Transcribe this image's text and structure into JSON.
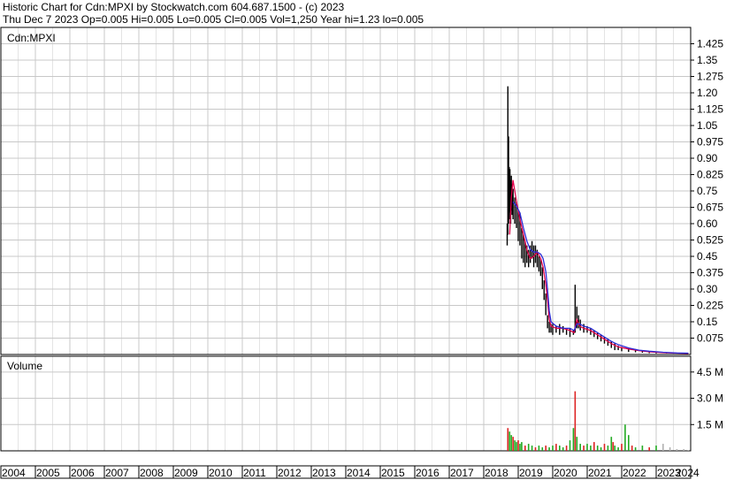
{
  "header": {
    "line1": "Historic Chart for Cdn:MPXI by Stockwatch.com 604.687.1500 - (c) 2023",
    "line2": "Thu Dec  7 2023  Op=0.005  Hi=0.005  Lo=0.005  Cl=0.005  Vol=1,250  Year hi=1.23  lo=0.005"
  },
  "chart_data": [
    {
      "type": "line",
      "title": "Cdn:MPXI",
      "ylim": [
        0,
        1.5
      ],
      "y_ticks": [
        "1.425",
        "1.35",
        "1.275",
        "1.20",
        "1.125",
        "1.05",
        "0.975",
        "0.90",
        "0.825",
        "0.75",
        "0.675",
        "0.60",
        "0.525",
        "0.45",
        "0.375",
        "0.30",
        "0.225",
        "0.15",
        "0.075"
      ],
      "y_tick_values": [
        1.425,
        1.35,
        1.275,
        1.2,
        1.125,
        1.05,
        0.975,
        0.9,
        0.825,
        0.75,
        0.675,
        0.6,
        0.525,
        0.45,
        0.375,
        0.3,
        0.225,
        0.15,
        0.075
      ],
      "x_range": [
        2004,
        2024
      ],
      "series": [
        {
          "values": [
            [
              2018.75,
              0.55
            ],
            [
              2018.8,
              0.72
            ],
            [
              2018.85,
              0.8
            ],
            [
              2018.95,
              0.7
            ],
            [
              2019.05,
              0.62
            ],
            [
              2019.15,
              0.55
            ],
            [
              2019.25,
              0.48
            ],
            [
              2019.35,
              0.44
            ],
            [
              2019.45,
              0.45
            ],
            [
              2019.55,
              0.47
            ],
            [
              2019.65,
              0.44
            ],
            [
              2019.72,
              0.4
            ],
            [
              2019.8,
              0.32
            ],
            [
              2019.85,
              0.25
            ],
            [
              2019.9,
              0.16
            ],
            [
              2019.95,
              0.13
            ],
            [
              2020.1,
              0.12
            ],
            [
              2020.3,
              0.12
            ],
            [
              2020.5,
              0.11
            ],
            [
              2020.62,
              0.1
            ],
            [
              2020.7,
              0.16
            ],
            [
              2020.78,
              0.13
            ],
            [
              2020.9,
              0.12
            ],
            [
              2021.1,
              0.11
            ],
            [
              2021.3,
              0.09
            ],
            [
              2021.5,
              0.07
            ],
            [
              2021.7,
              0.05
            ],
            [
              2021.9,
              0.035
            ],
            [
              2022.2,
              0.025
            ],
            [
              2022.5,
              0.018
            ],
            [
              2022.8,
              0.012
            ],
            [
              2023.2,
              0.008
            ],
            [
              2023.6,
              0.006
            ],
            [
              2023.93,
              0.005
            ]
          ]
        },
        {
          "values": [
            [
              2018.85,
              0.7
            ],
            [
              2018.95,
              0.68
            ],
            [
              2019.05,
              0.65
            ],
            [
              2019.15,
              0.58
            ],
            [
              2019.25,
              0.52
            ],
            [
              2019.35,
              0.48
            ],
            [
              2019.45,
              0.47
            ],
            [
              2019.55,
              0.47
            ],
            [
              2019.65,
              0.46
            ],
            [
              2019.72,
              0.44
            ],
            [
              2019.8,
              0.38
            ],
            [
              2019.85,
              0.3
            ],
            [
              2019.9,
              0.2
            ],
            [
              2019.95,
              0.15
            ],
            [
              2020.1,
              0.13
            ],
            [
              2020.3,
              0.12
            ],
            [
              2020.5,
              0.12
            ],
            [
              2020.62,
              0.11
            ],
            [
              2020.7,
              0.14
            ],
            [
              2020.78,
              0.14
            ],
            [
              2020.9,
              0.13
            ],
            [
              2021.1,
              0.12
            ],
            [
              2021.3,
              0.1
            ],
            [
              2021.5,
              0.08
            ],
            [
              2021.7,
              0.06
            ],
            [
              2021.9,
              0.045
            ],
            [
              2022.2,
              0.03
            ],
            [
              2022.5,
              0.02
            ],
            [
              2022.8,
              0.015
            ],
            [
              2023.2,
              0.01
            ],
            [
              2023.6,
              0.007
            ],
            [
              2023.93,
              0.006
            ]
          ]
        }
      ],
      "price_bars": [
        [
          2018.68,
          0.5,
          0.6
        ],
        [
          2018.7,
          0.55,
          1.23
        ],
        [
          2018.72,
          0.6,
          1.0
        ],
        [
          2018.74,
          0.62,
          0.86
        ],
        [
          2018.76,
          0.65,
          0.85
        ],
        [
          2018.78,
          0.6,
          0.8
        ],
        [
          2018.8,
          0.66,
          0.82
        ],
        [
          2018.82,
          0.64,
          0.78
        ],
        [
          2018.85,
          0.62,
          0.76
        ],
        [
          2018.9,
          0.6,
          0.72
        ],
        [
          2018.95,
          0.58,
          0.7
        ],
        [
          2019.0,
          0.52,
          0.66
        ],
        [
          2019.05,
          0.5,
          0.65
        ],
        [
          2019.1,
          0.44,
          0.58
        ],
        [
          2019.15,
          0.42,
          0.55
        ],
        [
          2019.2,
          0.4,
          0.52
        ],
        [
          2019.25,
          0.42,
          0.5
        ],
        [
          2019.3,
          0.4,
          0.48
        ],
        [
          2019.35,
          0.42,
          0.5
        ],
        [
          2019.4,
          0.44,
          0.52
        ],
        [
          2019.45,
          0.4,
          0.5
        ],
        [
          2019.5,
          0.42,
          0.5
        ],
        [
          2019.55,
          0.4,
          0.48
        ],
        [
          2019.6,
          0.38,
          0.45
        ],
        [
          2019.65,
          0.36,
          0.44
        ],
        [
          2019.7,
          0.3,
          0.4
        ],
        [
          2019.75,
          0.25,
          0.34
        ],
        [
          2019.8,
          0.18,
          0.28
        ],
        [
          2019.85,
          0.12,
          0.18
        ],
        [
          2019.9,
          0.1,
          0.15
        ],
        [
          2019.95,
          0.1,
          0.14
        ],
        [
          2020.0,
          0.09,
          0.14
        ],
        [
          2020.1,
          0.1,
          0.13
        ],
        [
          2020.2,
          0.09,
          0.14
        ],
        [
          2020.3,
          0.1,
          0.13
        ],
        [
          2020.4,
          0.09,
          0.12
        ],
        [
          2020.5,
          0.08,
          0.12
        ],
        [
          2020.6,
          0.09,
          0.11
        ],
        [
          2020.65,
          0.1,
          0.32
        ],
        [
          2020.7,
          0.12,
          0.22
        ],
        [
          2020.75,
          0.12,
          0.18
        ],
        [
          2020.8,
          0.11,
          0.16
        ],
        [
          2020.9,
          0.1,
          0.14
        ],
        [
          2021.0,
          0.1,
          0.13
        ],
        [
          2021.1,
          0.09,
          0.12
        ],
        [
          2021.2,
          0.08,
          0.11
        ],
        [
          2021.3,
          0.07,
          0.1
        ],
        [
          2021.4,
          0.06,
          0.09
        ],
        [
          2021.5,
          0.05,
          0.08
        ],
        [
          2021.6,
          0.04,
          0.07
        ],
        [
          2021.7,
          0.03,
          0.06
        ],
        [
          2021.8,
          0.02,
          0.05
        ],
        [
          2021.9,
          0.02,
          0.04
        ],
        [
          2022.0,
          0.015,
          0.035
        ],
        [
          2022.2,
          0.012,
          0.03
        ],
        [
          2022.4,
          0.01,
          0.025
        ],
        [
          2022.6,
          0.008,
          0.02
        ],
        [
          2022.8,
          0.006,
          0.015
        ],
        [
          2023.0,
          0.005,
          0.012
        ],
        [
          2023.3,
          0.005,
          0.01
        ],
        [
          2023.6,
          0.005,
          0.008
        ],
        [
          2023.93,
          0.005,
          0.006
        ]
      ]
    },
    {
      "type": "bar",
      "title": "Volume",
      "ylim": [
        0,
        5.4
      ],
      "y_ticks": [
        "4.5 M",
        "3.0 M",
        "1.5 M"
      ],
      "y_tick_values": [
        4.5,
        3.0,
        1.5
      ],
      "x_labels": [
        "2004",
        "2005",
        "2006",
        "2007",
        "2008",
        "2009",
        "2010",
        "2011",
        "2012",
        "2013",
        "2014",
        "2015",
        "2016",
        "2017",
        "2018",
        "2019",
        "2020",
        "2021",
        "2022",
        "2023",
        "2024"
      ],
      "bars": [
        [
          2018.7,
          1.3
        ],
        [
          2018.75,
          1.1
        ],
        [
          2018.8,
          0.9
        ],
        [
          2018.85,
          0.8
        ],
        [
          2018.9,
          0.6
        ],
        [
          2018.95,
          0.5
        ],
        [
          2019.0,
          0.6
        ],
        [
          2019.05,
          0.4
        ],
        [
          2019.1,
          0.5
        ],
        [
          2019.2,
          0.3
        ],
        [
          2019.3,
          0.4
        ],
        [
          2019.4,
          0.3
        ],
        [
          2019.5,
          0.2
        ],
        [
          2019.6,
          0.3
        ],
        [
          2019.7,
          0.2
        ],
        [
          2019.8,
          0.3
        ],
        [
          2019.9,
          0.2
        ],
        [
          2020.0,
          0.3
        ],
        [
          2020.1,
          0.4
        ],
        [
          2020.2,
          0.3
        ],
        [
          2020.3,
          0.2
        ],
        [
          2020.4,
          0.3
        ],
        [
          2020.5,
          0.6
        ],
        [
          2020.6,
          1.3
        ],
        [
          2020.65,
          3.4
        ],
        [
          2020.7,
          0.8
        ],
        [
          2020.8,
          0.4
        ],
        [
          2020.9,
          0.3
        ],
        [
          2021.0,
          0.4
        ],
        [
          2021.1,
          0.3
        ],
        [
          2021.2,
          0.5
        ],
        [
          2021.3,
          0.3
        ],
        [
          2021.4,
          0.2
        ],
        [
          2021.5,
          0.4
        ],
        [
          2021.6,
          0.3
        ],
        [
          2021.7,
          0.8
        ],
        [
          2021.75,
          0.5
        ],
        [
          2021.8,
          0.3
        ],
        [
          2021.9,
          0.2
        ],
        [
          2022.0,
          0.4
        ],
        [
          2022.1,
          1.5
        ],
        [
          2022.2,
          0.9
        ],
        [
          2022.3,
          0.3
        ],
        [
          2022.4,
          0.2
        ],
        [
          2022.6,
          0.3
        ],
        [
          2022.8,
          0.2
        ],
        [
          2023.0,
          0.3
        ],
        [
          2023.2,
          0.4
        ],
        [
          2023.4,
          0.2
        ],
        [
          2023.6,
          0.1
        ],
        [
          2023.8,
          0.1
        ],
        [
          2023.93,
          0.05
        ]
      ]
    }
  ]
}
